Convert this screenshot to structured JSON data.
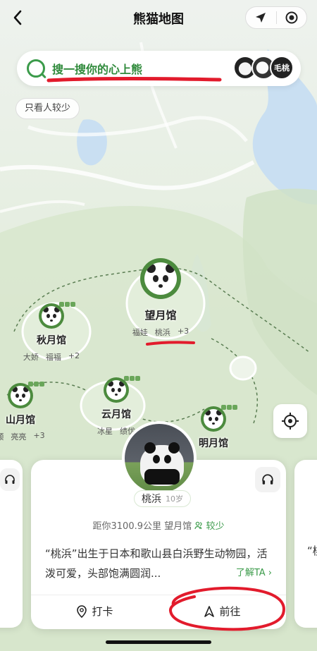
{
  "header": {
    "title": "熊猫地图"
  },
  "search": {
    "text": "搜一搜你的心上熊",
    "avatar_label": "毛桃"
  },
  "filter_chip": "只看人较少",
  "halls": [
    {
      "name": "望月馆",
      "pandas": [
        "福娃",
        "桃浜"
      ],
      "more": "+3"
    },
    {
      "name": "秋月馆",
      "pandas": [
        "大娇",
        "福福"
      ],
      "more": "+2"
    },
    {
      "name": "山月馆",
      "pandas": [
        "顺",
        "亮亮"
      ],
      "more": "+3"
    },
    {
      "name": "云月馆",
      "pandas": [
        "冰星",
        "绩优"
      ],
      "more": ""
    },
    {
      "name": "明月馆",
      "pandas": [],
      "more": ""
    }
  ],
  "card": {
    "panda_name": "桃浜",
    "age": "10岁",
    "distance": "距你3100.9公里",
    "hall": "望月馆",
    "crowd": "较少",
    "description": "“桃浜”出生于日本和歌山县白浜野生动物园，活泼可爱，头部饱满圆润...",
    "more_link": "了解TA ›",
    "checkin_label": "打卡",
    "go_label": "前往"
  },
  "side_card_peek_text": "“桃"
}
